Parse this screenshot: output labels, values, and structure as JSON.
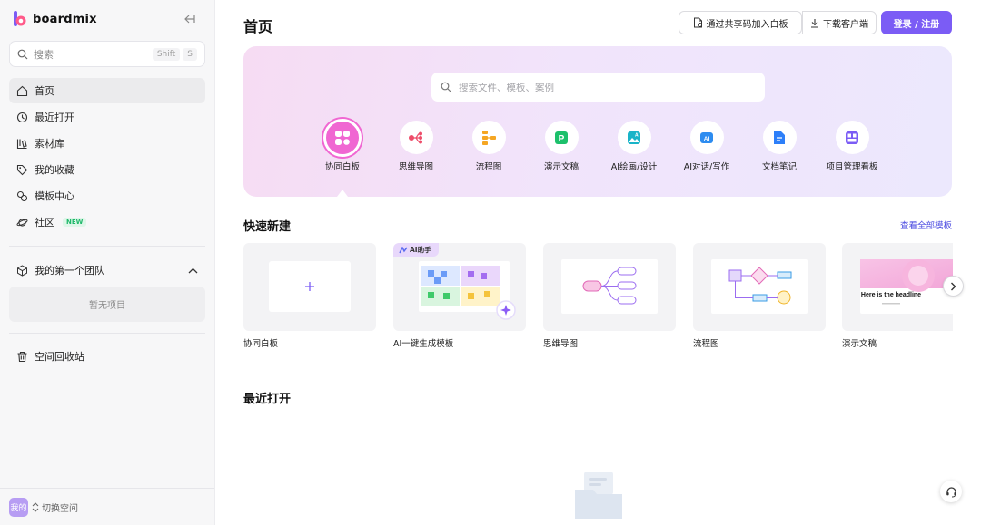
{
  "brand": {
    "name": "boardmix"
  },
  "sidebar": {
    "search": {
      "placeholder": "搜索",
      "kbd1": "Shift",
      "kbd2": "S"
    },
    "items": [
      {
        "label": "首页",
        "icon": "home-icon"
      },
      {
        "label": "最近打开",
        "icon": "clock-icon"
      },
      {
        "label": "素材库",
        "icon": "library-icon"
      },
      {
        "label": "我的收藏",
        "icon": "tag-icon"
      },
      {
        "label": "模板中心",
        "icon": "template-icon"
      },
      {
        "label": "社区",
        "icon": "planet-icon",
        "badge": "NEW"
      }
    ],
    "team": {
      "label": "我的第一个团队",
      "empty": "暂无项目"
    },
    "trash": {
      "label": "空间回收站"
    },
    "workspace": {
      "avatar": "我的",
      "switch_label": "切换空间"
    }
  },
  "header": {
    "title": "首页",
    "join_label": "通过共享码加入白板",
    "download_label": "下载客户端",
    "login_label": "登录 / 注册"
  },
  "hero": {
    "search_placeholder": "搜索文件、模板、案例",
    "tools": [
      {
        "label": "协同白板",
        "icon": "whiteboard-icon",
        "color": "#f067d2"
      },
      {
        "label": "思维导图",
        "icon": "mindmap-icon",
        "color": "#ee4d6a"
      },
      {
        "label": "流程图",
        "icon": "flowchart-icon",
        "color": "#f5a623"
      },
      {
        "label": "演示文稿",
        "icon": "presentation-icon",
        "color": "#1cc06b"
      },
      {
        "label": "AI绘画/设计",
        "icon": "ai-paint-icon",
        "color": "#19b4c8"
      },
      {
        "label": "AI对话/写作",
        "icon": "ai-write-icon",
        "color": "#2d8cf0"
      },
      {
        "label": "文档笔记",
        "icon": "doc-icon",
        "color": "#2d7ff9"
      },
      {
        "label": "项目管理看板",
        "icon": "kanban-icon",
        "color": "#7b5cf5"
      }
    ]
  },
  "quick_new": {
    "title": "快速新建",
    "view_all": "查看全部模板",
    "cards": [
      {
        "name": "协同白板"
      },
      {
        "name": "AI一键生成模板",
        "tag": "AI助手"
      },
      {
        "name": "思维导图"
      },
      {
        "name": "流程图"
      },
      {
        "name": "演示文稿",
        "preview_text": "Here is the headline"
      }
    ]
  },
  "recent": {
    "title": "最近打开"
  }
}
